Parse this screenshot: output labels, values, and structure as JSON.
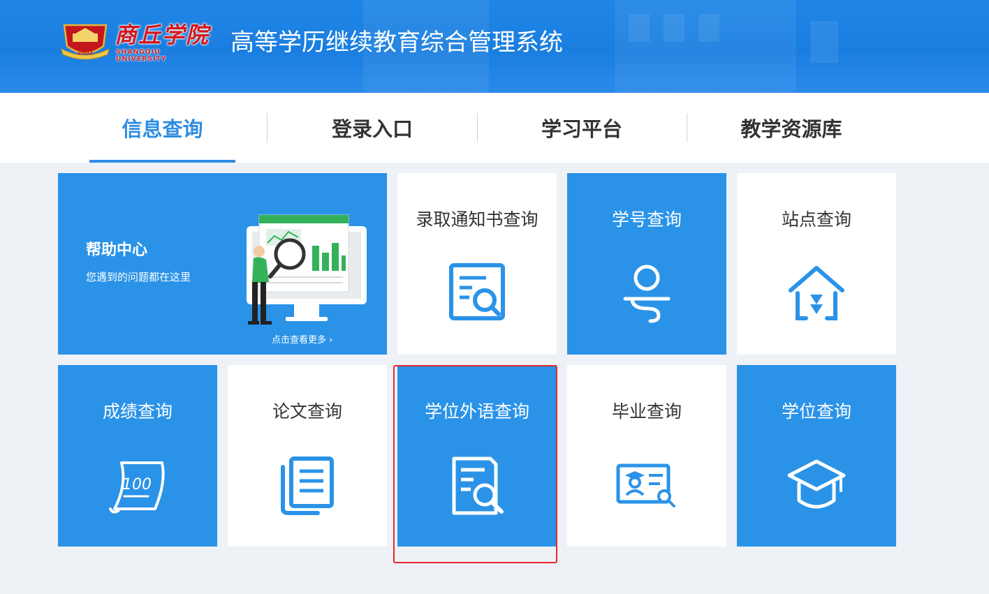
{
  "header": {
    "logo_script": "商丘学院",
    "logo_english": "SHANGQIU UNIVERSITY",
    "logo_year": "2002",
    "system_title": "高等学历继续教育综合管理系统"
  },
  "nav": {
    "tabs": [
      {
        "label": "信息查询",
        "active": true
      },
      {
        "label": "登录入口",
        "active": false
      },
      {
        "label": "学习平台",
        "active": false
      },
      {
        "label": "教学资源库",
        "active": false
      }
    ]
  },
  "help_center": {
    "title": "帮助中心",
    "subtitle": "您遇到的问题都在这里",
    "more_link": "点击查看更多"
  },
  "tiles": [
    {
      "label": "录取通知书查询",
      "icon": "document-search-icon"
    },
    {
      "label": "学号查询",
      "icon": "user-id-icon"
    },
    {
      "label": "站点查询",
      "icon": "house-location-icon"
    },
    {
      "label": "成绩查询",
      "icon": "score-100-icon"
    },
    {
      "label": "论文查询",
      "icon": "book-icon"
    },
    {
      "label": "学位外语查询",
      "icon": "document-magnifier-icon"
    },
    {
      "label": "毕业查询",
      "icon": "certificate-icon"
    },
    {
      "label": "学位查询",
      "icon": "graduation-cap-icon"
    }
  ],
  "colors": {
    "primary_blue": "#2a93e8",
    "active_tab": "#2e8de3",
    "highlight_border": "#e8282b",
    "logo_red": "#d4171c"
  }
}
